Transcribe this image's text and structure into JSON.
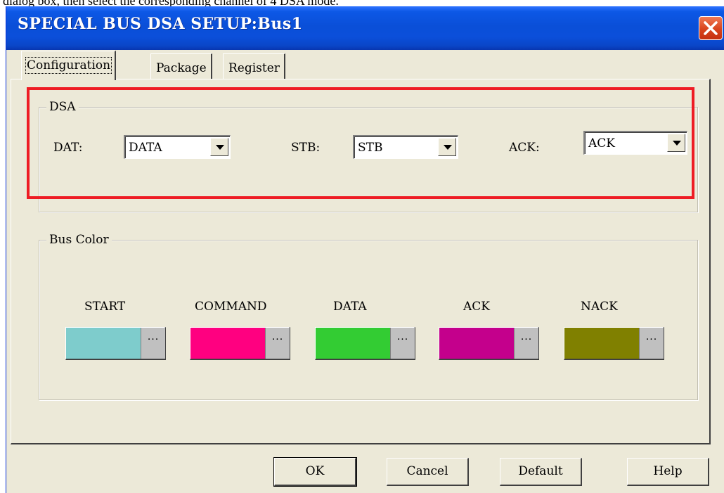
{
  "top_caption": "dialog box, then select the corresponding channel of 4 DSA mode.",
  "window": {
    "title": "SPECIAL BUS DSA SETUP:Bus1"
  },
  "tabs": [
    {
      "label": "Configuration",
      "active": true
    },
    {
      "label": "Package",
      "active": false
    },
    {
      "label": "Register",
      "active": false
    }
  ],
  "dsa": {
    "group_label": "DSA",
    "dat_label": "DAT:",
    "dat_value": "DATA",
    "stb_label": "STB:",
    "stb_value": "STB",
    "ack_label": "ACK:",
    "ack_value": "ACK"
  },
  "bus_color": {
    "group_label": "Bus Color",
    "items": [
      {
        "label": "START",
        "color": "#7ecccc"
      },
      {
        "label": "COMMAND",
        "color": "#ff0080"
      },
      {
        "label": "DATA",
        "color": "#33cc33"
      },
      {
        "label": "ACK",
        "color": "#c4008c"
      },
      {
        "label": "NACK",
        "color": "#808000"
      }
    ],
    "button_glyph": "..."
  },
  "buttons": {
    "ok": "OK",
    "cancel": "Cancel",
    "default": "Default",
    "help": "Help"
  },
  "annotation_color": "#ee1c24",
  "icons": {
    "close": "close-icon",
    "dropdown": "chevron-down-icon"
  }
}
